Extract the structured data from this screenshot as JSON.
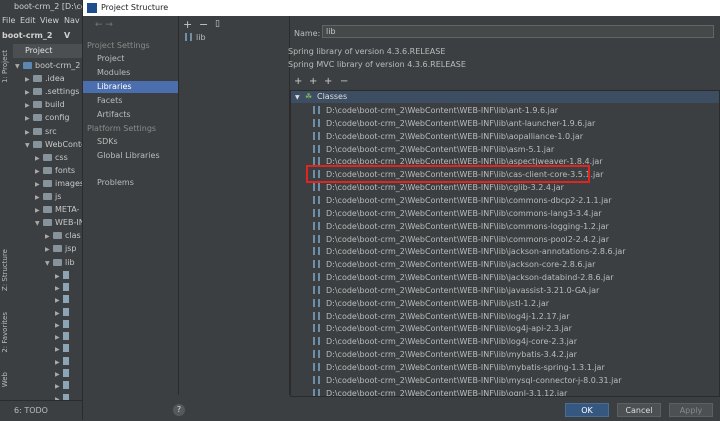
{
  "ide": {
    "window_title": "boot-crm_2 [D:\\code",
    "menu": [
      "File",
      "Edit",
      "View",
      "Nav"
    ],
    "breadcrumb": [
      "boot-crm_2",
      "V"
    ],
    "project_dropdown": "Project",
    "tree": [
      {
        "label": "boot-crm_2 [D",
        "depth": 0,
        "expanded": true
      },
      {
        "label": ".idea",
        "depth": 1,
        "expanded": false
      },
      {
        "label": ".settings",
        "depth": 1,
        "expanded": false
      },
      {
        "label": "build",
        "depth": 1,
        "expanded": false
      },
      {
        "label": "config",
        "depth": 1,
        "expanded": false
      },
      {
        "label": "src",
        "depth": 1,
        "expanded": false
      },
      {
        "label": "WebConte",
        "depth": 1,
        "expanded": true
      },
      {
        "label": "css",
        "depth": 2,
        "expanded": false
      },
      {
        "label": "fonts",
        "depth": 2,
        "expanded": false
      },
      {
        "label": "images",
        "depth": 2,
        "expanded": false
      },
      {
        "label": "js",
        "depth": 2,
        "expanded": false
      },
      {
        "label": "META-",
        "depth": 2,
        "expanded": false
      },
      {
        "label": "WEB-IN",
        "depth": 2,
        "expanded": true
      },
      {
        "label": "clas",
        "depth": 3,
        "expanded": false
      },
      {
        "label": "jsp",
        "depth": 3,
        "expanded": false
      },
      {
        "label": "lib",
        "depth": 3,
        "expanded": true
      }
    ],
    "lib_children_count": 11,
    "side_tabs": {
      "project": "1: Project",
      "structure": "Z: Structure",
      "favorites": "2: Favorites",
      "web": "Web"
    },
    "status_todo": "6: TODO"
  },
  "dialog": {
    "title": "Project Structure",
    "nav": {
      "project_settings": "Project Settings",
      "project": "Project",
      "modules": "Modules",
      "libraries": "Libraries",
      "facets": "Facets",
      "artifacts": "Artifacts",
      "platform_settings": "Platform Settings",
      "sdks": "SDKs",
      "global_libraries": "Global Libraries",
      "problems": "Problems"
    },
    "library_list": [
      "lib"
    ],
    "name_label": "Name:",
    "name_value": "lib",
    "descriptions": [
      "Spring library of version 4.3.6.RELEASE",
      "Spring MVC library of version 4.3.6.RELEASE"
    ],
    "classes_header": "Classes",
    "jars": [
      "D:\\code\\boot-crm_2\\WebContent\\WEB-INF\\lib\\ant-1.9.6.jar",
      "D:\\code\\boot-crm_2\\WebContent\\WEB-INF\\lib\\ant-launcher-1.9.6.jar",
      "D:\\code\\boot-crm_2\\WebContent\\WEB-INF\\lib\\aopalliance-1.0.jar",
      "D:\\code\\boot-crm_2\\WebContent\\WEB-INF\\lib\\asm-5.1.jar",
      "D:\\code\\boot-crm_2\\WebContent\\WEB-INF\\lib\\aspectjweaver-1.8.4.jar",
      "D:\\code\\boot-crm_2\\WebContent\\WEB-INF\\lib\\cas-client-core-3.5.1.jar",
      "D:\\code\\boot-crm_2\\WebContent\\WEB-INF\\lib\\cglib-3.2.4.jar",
      "D:\\code\\boot-crm_2\\WebContent\\WEB-INF\\lib\\commons-dbcp2-2.1.1.jar",
      "D:\\code\\boot-crm_2\\WebContent\\WEB-INF\\lib\\commons-lang3-3.4.jar",
      "D:\\code\\boot-crm_2\\WebContent\\WEB-INF\\lib\\commons-logging-1.2.jar",
      "D:\\code\\boot-crm_2\\WebContent\\WEB-INF\\lib\\commons-pool2-2.4.2.jar",
      "D:\\code\\boot-crm_2\\WebContent\\WEB-INF\\lib\\jackson-annotations-2.8.6.jar",
      "D:\\code\\boot-crm_2\\WebContent\\WEB-INF\\lib\\jackson-core-2.8.6.jar",
      "D:\\code\\boot-crm_2\\WebContent\\WEB-INF\\lib\\jackson-databind-2.8.6.jar",
      "D:\\code\\boot-crm_2\\WebContent\\WEB-INF\\lib\\javassist-3.21.0-GA.jar",
      "D:\\code\\boot-crm_2\\WebContent\\WEB-INF\\lib\\jstl-1.2.jar",
      "D:\\code\\boot-crm_2\\WebContent\\WEB-INF\\lib\\log4j-1.2.17.jar",
      "D:\\code\\boot-crm_2\\WebContent\\WEB-INF\\lib\\log4j-api-2.3.jar",
      "D:\\code\\boot-crm_2\\WebContent\\WEB-INF\\lib\\log4j-core-2.3.jar",
      "D:\\code\\boot-crm_2\\WebContent\\WEB-INF\\lib\\mybatis-3.4.2.jar",
      "D:\\code\\boot-crm_2\\WebContent\\WEB-INF\\lib\\mybatis-spring-1.3.1.jar",
      "D:\\code\\boot-crm_2\\WebContent\\WEB-INF\\lib\\mysql-connector-j-8.0.31.jar",
      "D:\\code\\boot-crm_2\\WebContent\\WEB-INF\\lib\\ognl-3.1.12.jar"
    ],
    "highlighted_jar": "D:\\code\\boot-crm_2\\WebContent\\WEB-INF\\lib\\cas-client-core-3.5.1.jar",
    "buttons": {
      "ok": "OK",
      "cancel": "Cancel",
      "apply": "Apply",
      "help": "?"
    },
    "toolbar": {
      "add": "+",
      "remove": "−"
    },
    "classes_toolbar": {
      "add": "+",
      "add_alt": "+",
      "add_other": "+",
      "remove": "−"
    }
  },
  "colors": {
    "selection": "#4b6eaf",
    "highlight": "#e0241f",
    "ok_button": "#365880"
  }
}
